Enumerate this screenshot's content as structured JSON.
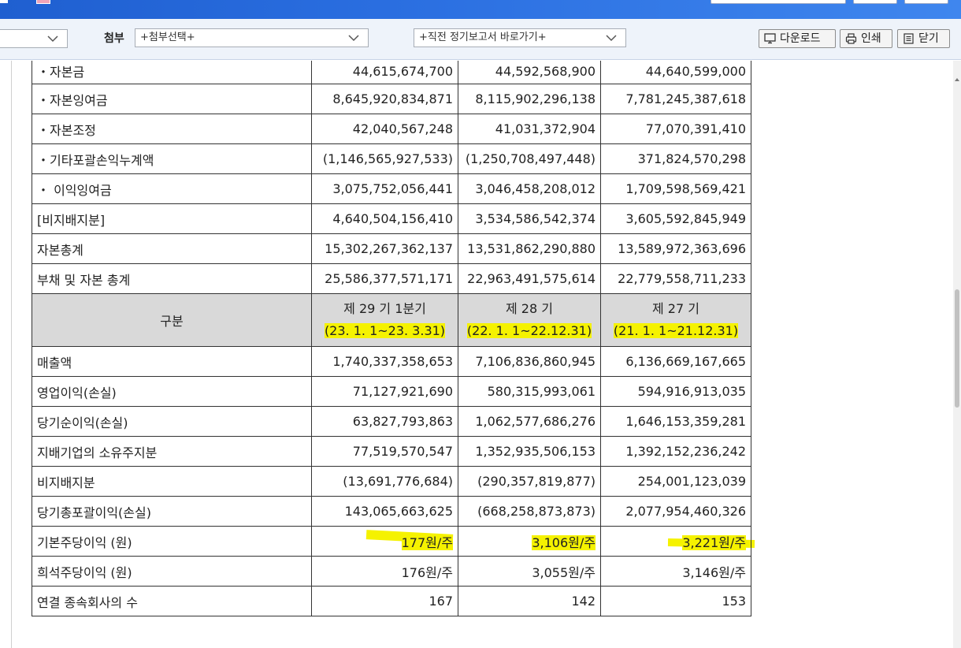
{
  "toolbar": {
    "attach_label": "첨부",
    "attach_select": "+첨부선택+",
    "report_select": "+직전 정기보고서 바로가기+",
    "download_label": "다운로드",
    "print_label": "인쇄",
    "close_label": "닫기",
    "icons": [
      "chevron-down-icon",
      "monitor-download-icon",
      "printer-icon",
      "document-close-icon"
    ]
  },
  "table": {
    "rows_top": [
      {
        "label": "・자본금",
        "v1": "44,615,674,700",
        "v2": "44,592,568,900",
        "v3": "44,640,599,000"
      },
      {
        "label": "・자본잉여금",
        "v1": "8,645,920,834,871",
        "v2": "8,115,902,296,138",
        "v3": "7,781,245,387,618"
      },
      {
        "label": "・자본조정",
        "v1": "42,040,567,248",
        "v2": "41,031,372,904",
        "v3": "77,070,391,410"
      },
      {
        "label": "・기타포괄손익누계액",
        "v1": "(1,146,565,927,533)",
        "v2": "(1,250,708,497,448)",
        "v3": "371,824,570,298"
      },
      {
        "label": "・ 이익잉여금",
        "v1": "3,075,752,056,441",
        "v2": "3,046,458,208,012",
        "v3": "1,709,598,569,421"
      },
      {
        "label": "[비지배지분]",
        "v1": "4,640,504,156,410",
        "v2": "3,534,586,542,374",
        "v3": "3,605,592,845,949"
      },
      {
        "label": "자본총계",
        "v1": "15,302,267,362,137",
        "v2": "13,531,862,290,880",
        "v3": "13,589,972,363,696"
      },
      {
        "label": "부채 및 자본 총계",
        "v1": "25,586,377,571,171",
        "v2": "22,963,491,575,614",
        "v3": "22,779,558,711,233"
      }
    ],
    "header": {
      "label": "구분",
      "p1_title": "제 29 기 1분기",
      "p1_range": "(23. 1. 1~23. 3.31)",
      "p2_title": "제 28 기",
      "p2_range": "(22. 1. 1~22.12.31)",
      "p3_title": "제 27 기",
      "p3_range": "(21. 1. 1~21.12.31)"
    },
    "rows_bottom": [
      {
        "label": "매출액",
        "v1": "1,740,337,358,653",
        "v2": "7,106,836,860,945",
        "v3": "6,136,669,167,665"
      },
      {
        "label": "영업이익(손실)",
        "v1": "71,127,921,690",
        "v2": "580,315,993,061",
        "v3": "594,916,913,035"
      },
      {
        "label": "당기순이익(손실)",
        "v1": "63,827,793,863",
        "v2": "1,062,577,686,276",
        "v3": "1,646,153,359,281"
      },
      {
        "label": "지배기업의 소유주지분",
        "v1": "77,519,570,547",
        "v2": "1,352,935,506,153",
        "v3": "1,392,152,236,242"
      },
      {
        "label": "비지배지분",
        "v1": "(13,691,776,684)",
        "v2": "(290,357,819,877)",
        "v3": "254,001,123,039"
      },
      {
        "label": "당기총포괄이익(손실)",
        "v1": "143,065,663,625",
        "v2": "(668,258,873,873)",
        "v3": "2,077,954,460,326"
      },
      {
        "label": "기본주당이익 (원)",
        "v1": "177원/주",
        "v2": "3,106원/주",
        "v3": "3,221원/주"
      },
      {
        "label": "희석주당이익 (원)",
        "v1": "176원/주",
        "v2": "3,055원/주",
        "v3": "3,146원/주"
      },
      {
        "label": "연결 종속회사의 수",
        "v1": "167",
        "v2": "142",
        "v3": "153"
      }
    ]
  },
  "colors": {
    "highlight": "#f5f200",
    "header_bg": "#d9d9d9",
    "titlebar": "#2a6ee0",
    "toolbar_bg": "#eef3fa"
  }
}
